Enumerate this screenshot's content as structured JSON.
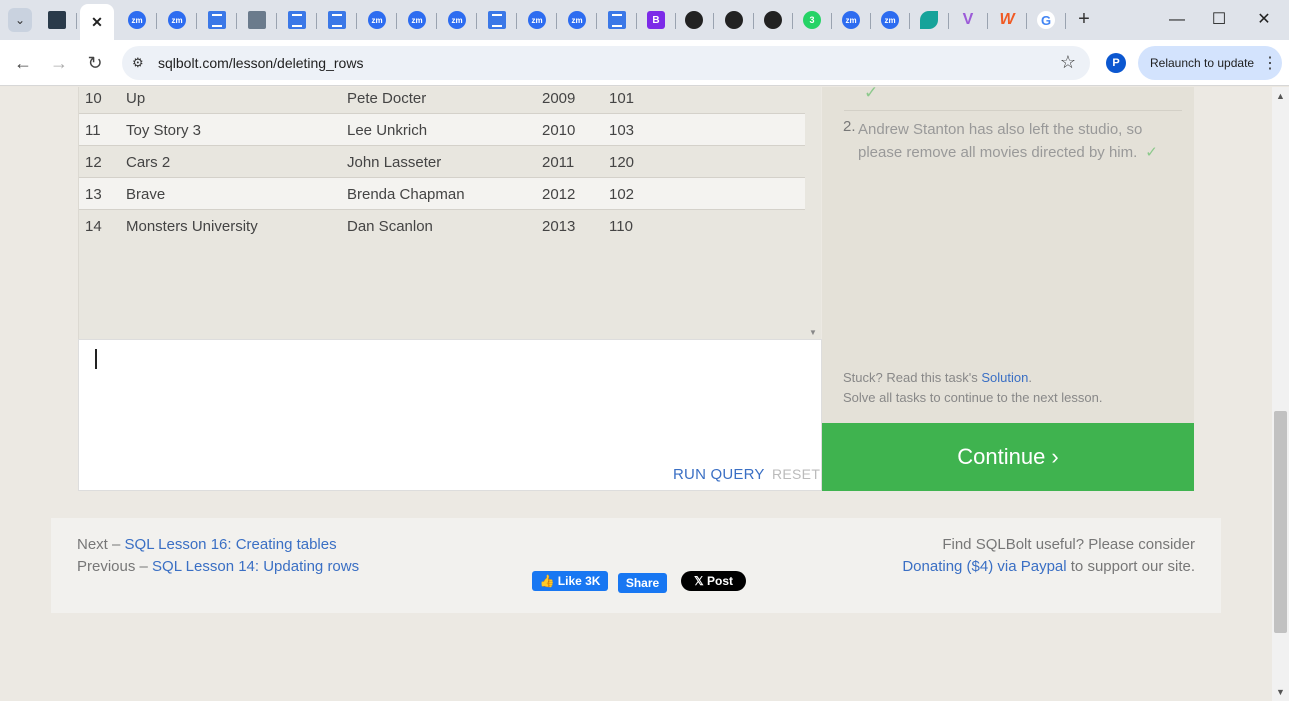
{
  "browser": {
    "tabs": [
      {
        "icon": "tab-list",
        "active": false
      },
      {
        "icon": "db",
        "active": false
      },
      {
        "icon": "close",
        "active": true,
        "label": "✕"
      },
      {
        "icon": "zm",
        "label": "zm"
      },
      {
        "icon": "zm",
        "label": "zm"
      },
      {
        "icon": "doc",
        "label": ""
      },
      {
        "icon": "tbl",
        "label": ""
      },
      {
        "icon": "doc",
        "label": ""
      },
      {
        "icon": "doc",
        "label": ""
      },
      {
        "icon": "zm",
        "label": "zm"
      },
      {
        "icon": "zm",
        "label": "zm"
      },
      {
        "icon": "zm",
        "label": "zm"
      },
      {
        "icon": "doc",
        "label": ""
      },
      {
        "icon": "zm",
        "label": "zm"
      },
      {
        "icon": "zm",
        "label": "zm"
      },
      {
        "icon": "doc",
        "label": ""
      },
      {
        "icon": "bs",
        "label": "B"
      },
      {
        "icon": "gh",
        "label": ""
      },
      {
        "icon": "gh",
        "label": ""
      },
      {
        "icon": "gh",
        "label": ""
      },
      {
        "icon": "num",
        "label": "3"
      },
      {
        "icon": "zm",
        "label": "zm"
      },
      {
        "icon": "zm",
        "label": "zm"
      },
      {
        "icon": "leaf",
        "label": ""
      },
      {
        "icon": "vee",
        "label": "V"
      },
      {
        "icon": "w",
        "label": "W"
      },
      {
        "icon": "g",
        "label": "G"
      }
    ],
    "new_tab_label": "+",
    "url": "sqlbolt.com/lesson/deleting_rows",
    "profile_initial": "P",
    "relaunch_label": "Relaunch to update"
  },
  "results": {
    "rows": [
      {
        "id": "10",
        "title": "Up",
        "director": "Pete Docter",
        "year": "2009",
        "length": "101"
      },
      {
        "id": "11",
        "title": "Toy Story 3",
        "director": "Lee Unkrich",
        "year": "2010",
        "length": "103"
      },
      {
        "id": "12",
        "title": "Cars 2",
        "director": "John Lasseter",
        "year": "2011",
        "length": "120"
      },
      {
        "id": "13",
        "title": "Brave",
        "director": "Brenda Chapman",
        "year": "2012",
        "length": "102"
      },
      {
        "id": "14",
        "title": "Monsters University",
        "director": "Dan Scanlon",
        "year": "2013",
        "length": "110"
      }
    ]
  },
  "editor": {
    "run_label": "RUN QUERY",
    "reset_label": "RESET"
  },
  "tasks": {
    "prev_check": "✓",
    "task_number": "2.",
    "task_text": "Andrew Stanton has also left the studio, so please remove all movies directed by him.",
    "task_check": "✓",
    "stuck_prefix": "Stuck? Read this task's ",
    "solution_link": "Solution",
    "stuck_suffix": ".",
    "solve_text": "Solve all tasks to continue to the next lesson.",
    "continue_label": "Continue ›"
  },
  "footer": {
    "next_prefix": "Next – ",
    "next_link": "SQL Lesson 16: Creating tables",
    "prev_prefix": "Previous – ",
    "prev_link": "SQL Lesson 14: Updating rows",
    "find_text": "Find SQLBolt useful? Please consider",
    "donate_link": "Donating ($4) via Paypal",
    "donate_suffix": " to support our site."
  },
  "social": {
    "like_label": "👍 Like 3K",
    "share_label": "Share",
    "post_label": "𝕏 Post"
  }
}
